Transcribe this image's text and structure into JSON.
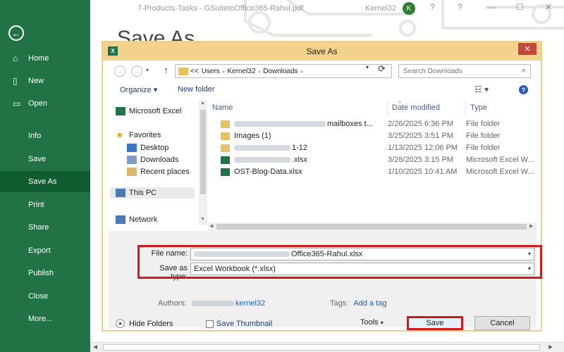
{
  "backstage": {
    "back_icon": "back-arrow-icon",
    "items": [
      {
        "label": "Home",
        "icon": "home-icon"
      },
      {
        "label": "New",
        "icon": "new-document-icon"
      },
      {
        "label": "Open",
        "icon": "open-folder-icon"
      },
      {
        "label": "Info"
      },
      {
        "label": "Save"
      },
      {
        "label": "Save As",
        "active": true
      },
      {
        "label": "Print"
      },
      {
        "label": "Share"
      },
      {
        "label": "Export"
      },
      {
        "label": "Publish"
      },
      {
        "label": "Close"
      },
      {
        "label": "More..."
      }
    ],
    "heading": "Save As"
  },
  "window": {
    "document_title": "7-Products-Tasks - GSuitetoOffice365-Rahul.pdf",
    "account": "Kernel32",
    "avatar_initial": "K",
    "controls": [
      "?",
      "—",
      "☐",
      "✕"
    ]
  },
  "dialog": {
    "title": "Save As",
    "address": {
      "crumbs": [
        "Users",
        "Kernel32",
        "Downloads"
      ],
      "prefix": "<<"
    },
    "search_placeholder": "Search Downloads",
    "toolbar": {
      "organize": "Organize",
      "new_folder": "New folder"
    },
    "nav": {
      "microsoft_excel": "Microsoft Excel",
      "favorites": "Favorites",
      "desktop": "Desktop",
      "downloads": "Downloads",
      "recent_places": "Recent places",
      "this_pc": "This PC",
      "network": "Network"
    },
    "columns": {
      "name": "Name",
      "date_modified": "Date modified",
      "type": "Type"
    },
    "files": [
      {
        "name_suffix": "mailboxes t...",
        "date": "2/26/2025 6:36 PM",
        "type": "File folder",
        "kind": "folder"
      },
      {
        "name_suffix": "Images (1)",
        "date": "3/25/2025 3:51 PM",
        "type": "File folder",
        "kind": "folder"
      },
      {
        "name_suffix": "1-12",
        "date": "1/13/2025 12:06 PM",
        "type": "File folder",
        "kind": "folder"
      },
      {
        "name_suffix": ".xlsx",
        "date": "3/28/2025 3:15 PM",
        "type": "Microsoft Excel W...",
        "kind": "excel"
      },
      {
        "name_suffix": "OST-Blog-Data.xlsx",
        "date": "1/10/2025 10:41 AM",
        "type": "Microsoft Excel W...",
        "kind": "excel"
      }
    ],
    "file_name_label": "File name:",
    "file_name_value": "Office365-Rahul.xlsx",
    "save_type_label": "Save as type:",
    "save_type_value": "Excel Workbook (*.xlsx)",
    "authors_label": "Authors:",
    "authors_value": "kernel32",
    "tags_label": "Tags:",
    "tags_value": "Add a tag",
    "save_thumbnail": "Save Thumbnail",
    "hide_folders": "Hide Folders",
    "tools": "Tools",
    "save": "Save",
    "cancel": "Cancel"
  }
}
